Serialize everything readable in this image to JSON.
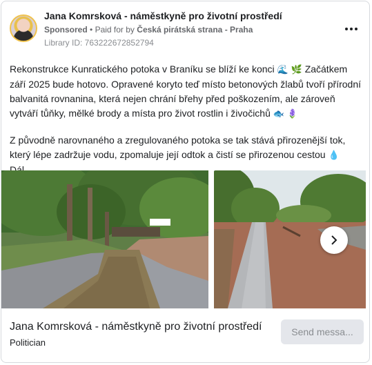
{
  "header": {
    "page_name": "Jana Komrsková - náměstkyně pro životní prostředí",
    "sponsored": "Sponsored",
    "separator": "•",
    "paid_for_by": "Paid for by",
    "payer": "Česká pirátská strana - Praha",
    "library_id": "Library ID: 763222672852794"
  },
  "post": {
    "paragraph1_a": "Rekonstrukce Kunratického potoka v Braníku se blíží ke konci",
    "paragraph1_b": "Začátkem září 2025 bude hotovo. Opravené koryto teď místo betonových žlabů tvoří přírodní balvanitá rovnanina, která nejen chrání břehy před poškozením, ale zároveň vytváří tůňky, mělké brody a místa pro život rostlin i živočichů",
    "paragraph2": "Z původně narovnaného a zregulovaného potoka se tak stává přirozenější tok, který lépe zadržuje vodu, zpomaluje její odtok a čistí se přirozenou cestou",
    "see_more": "Dál…"
  },
  "icons": {
    "wave": "🌊",
    "herb": "🌿",
    "fish": "🐟",
    "flower": "🪻",
    "droplet": "💧"
  },
  "footer": {
    "title": "Jana Komrsková - náměstkyně pro životní prostředí",
    "subtitle": "Politician",
    "send_button": "Send messa..."
  },
  "colors": {
    "text": "#1c1e21",
    "secondary": "#65676b",
    "button_bg": "#e4e6eb",
    "avatar_ring": "#f0c24b"
  }
}
